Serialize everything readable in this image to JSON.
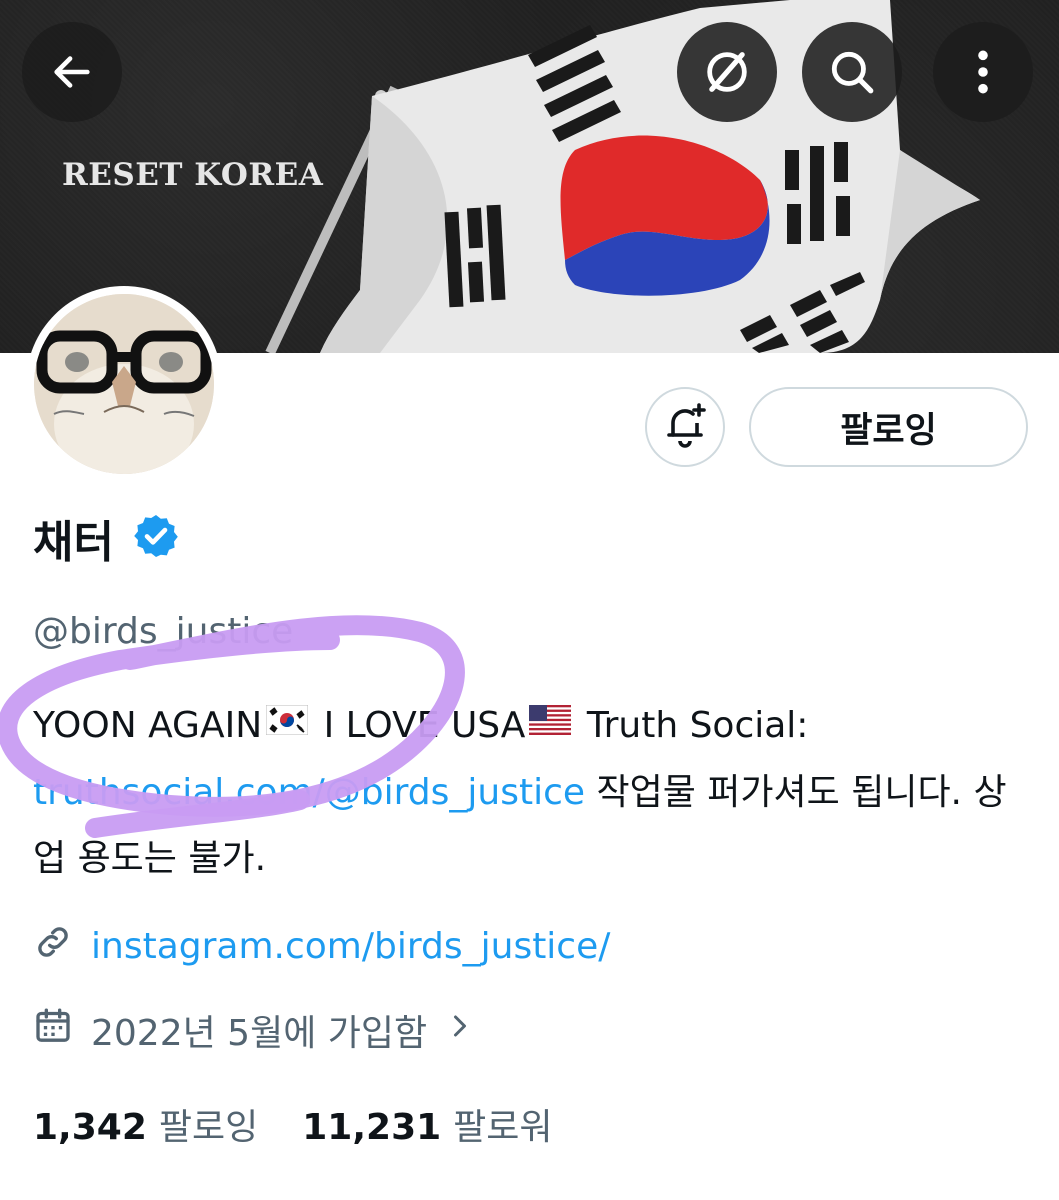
{
  "banner": {
    "text": "RESET KOREA"
  },
  "header_buttons": {
    "back_icon": "arrow-left-icon",
    "grok_icon": "slash-circle-icon",
    "search_icon": "search-icon",
    "more_icon": "more-vertical-icon"
  },
  "actions": {
    "notify_icon": "bell-plus-icon",
    "follow_label": "팔로잉"
  },
  "profile": {
    "display_name": "채터",
    "verified_icon": "verified-badge-icon",
    "handle": "@birds_justice",
    "bio": {
      "part1": "YOON AGAIN",
      "part2": " I LOVE USA",
      "part3": " Truth Social: ",
      "link": "truthsocial.com/@birds_justice",
      "part4": " 작업물 퍼가셔도 됩니다. 상업 용도는 불가."
    },
    "website": "instagram.com/birds_justice/",
    "joined": "2022년 5월에 가입함",
    "following_count": "1,342",
    "following_label": "팔로잉",
    "followers_count": "11,231",
    "followers_label": "팔로워"
  },
  "colors": {
    "link": "#1d9bf0",
    "verified": "#1d9bf0",
    "annotation": "#c89cf2",
    "muted": "#536471"
  }
}
